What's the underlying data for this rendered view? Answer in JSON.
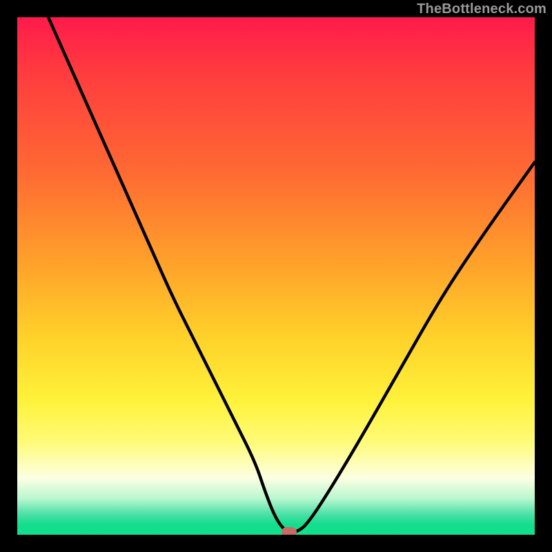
{
  "watermark": "TheBottleneck.com",
  "chart_data": {
    "type": "line",
    "title": "",
    "xlabel": "",
    "ylabel": "",
    "xlim": [
      0,
      100
    ],
    "ylim": [
      0,
      100
    ],
    "grid": false,
    "legend": false,
    "series": [
      {
        "name": "bottleneck-curve",
        "x": [
          6,
          10,
          14,
          18,
          22,
          26,
          30,
          34,
          38,
          42,
          46,
          48,
          50,
          52,
          54,
          56,
          60,
          66,
          74,
          82,
          90,
          100
        ],
        "y": [
          100,
          91,
          82,
          73,
          64,
          55,
          46,
          38,
          30,
          22,
          14,
          8,
          3,
          0.5,
          0.5,
          2,
          8,
          18,
          32,
          46,
          58,
          72
        ]
      }
    ],
    "marker": {
      "x": 52.5,
      "y": 0.5,
      "color": "#c96a65"
    },
    "background_gradient": {
      "top": "#ff1a4b",
      "bottom": "#11e08b",
      "stops": [
        "#ff1a4b",
        "#ff6a33",
        "#ffd22a",
        "#fdffe2",
        "#14dd8e"
      ]
    }
  }
}
